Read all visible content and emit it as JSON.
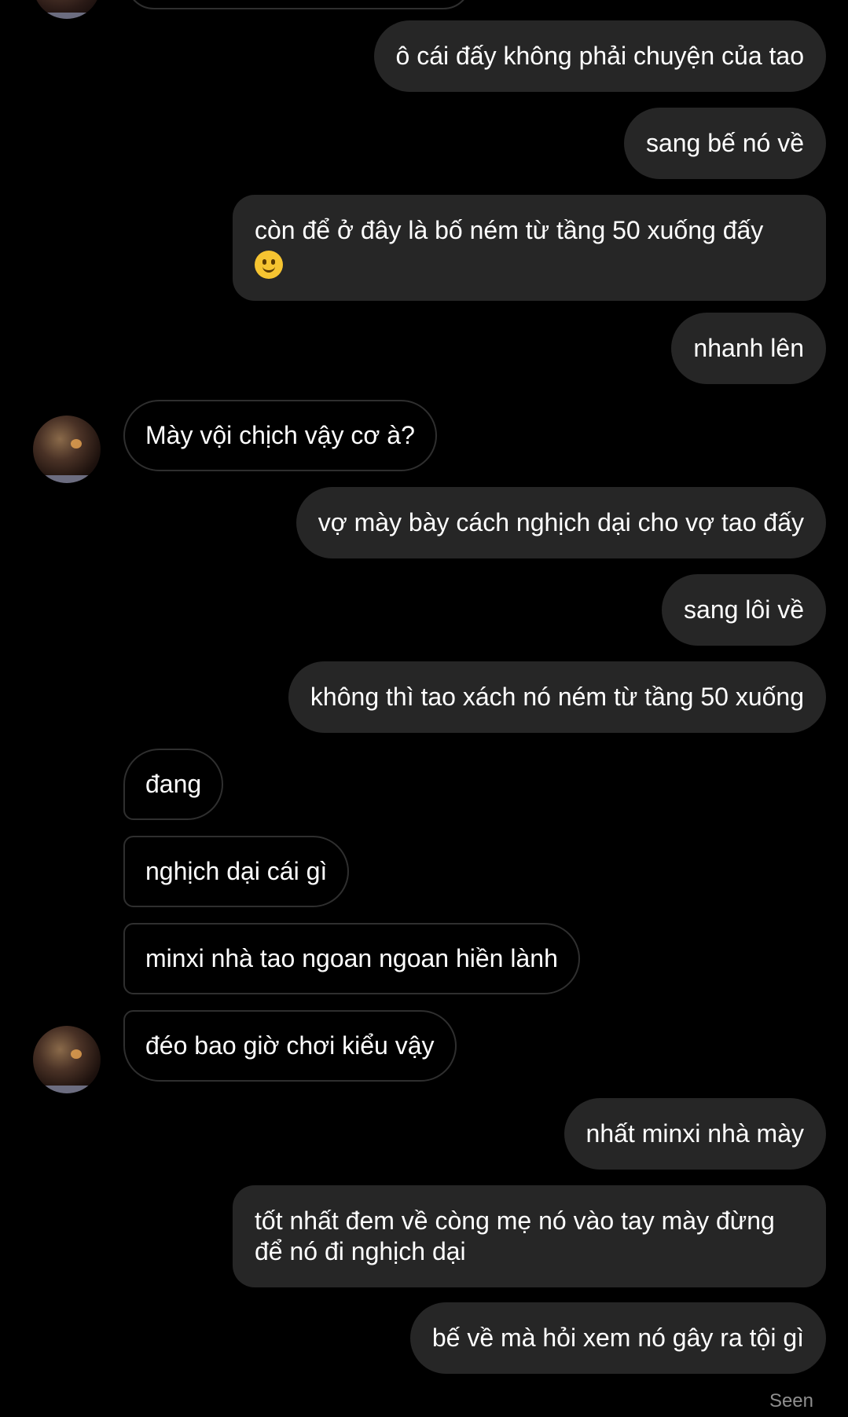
{
  "messages": [
    {
      "id": "m1",
      "dir": "out",
      "text": "ô cái đấy không phải chuyện của tao"
    },
    {
      "id": "m2",
      "dir": "out",
      "text": "sang bế nó về"
    },
    {
      "id": "m3",
      "dir": "out",
      "text": "còn để ở đây là bố ném từ tầng 50 xuống đấy",
      "emoji": "slightly-smiling-face"
    },
    {
      "id": "m4",
      "dir": "out",
      "text": "nhanh lên"
    },
    {
      "id": "m5",
      "dir": "in",
      "text": "Mày vội chịch vậy cơ à?"
    },
    {
      "id": "m6",
      "dir": "out",
      "text": "vợ mày bày cách nghịch dại cho vợ tao đấy"
    },
    {
      "id": "m7",
      "dir": "out",
      "text": "sang lôi về"
    },
    {
      "id": "m8",
      "dir": "out",
      "text": "không thì tao xách nó ném từ tầng 50 xuống"
    },
    {
      "id": "m9",
      "dir": "in",
      "text": "đang"
    },
    {
      "id": "m10",
      "dir": "in",
      "text": "nghịch dại cái gì"
    },
    {
      "id": "m11",
      "dir": "in",
      "text": "minxi nhà tao ngoan ngoan hiền lành"
    },
    {
      "id": "m12",
      "dir": "in",
      "text": "đéo bao giờ chơi kiểu vậy"
    },
    {
      "id": "m13",
      "dir": "out",
      "text": "nhất minxi nhà mày"
    },
    {
      "id": "m14",
      "dir": "out",
      "text": "tốt nhất đem về còng mẹ nó vào tay mày đừng để nó đi nghịch dại"
    },
    {
      "id": "m15",
      "dir": "out",
      "text": "bế về mà hỏi xem nó gây ra tội gì"
    }
  ],
  "status": {
    "seen": "Seen"
  },
  "colors": {
    "background": "#000000",
    "outgoing_bubble": "#262626",
    "incoming_border": "#2f2f2f",
    "text": "#ffffff",
    "seen_text": "#8e8e8e"
  }
}
